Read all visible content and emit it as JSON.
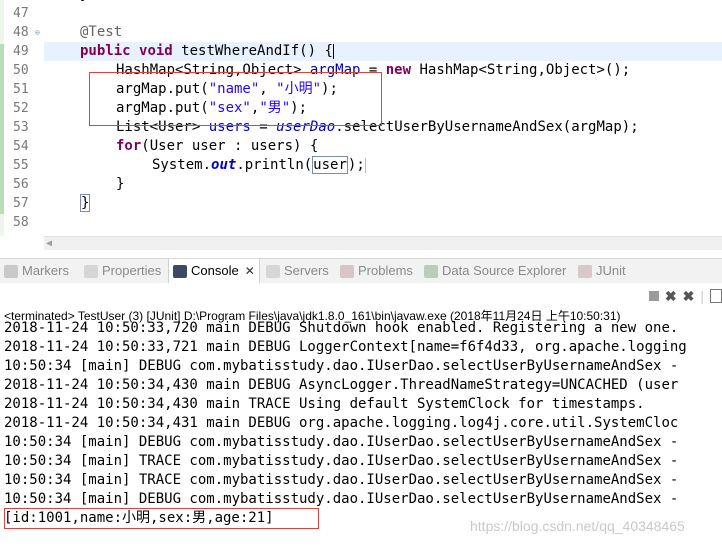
{
  "editor": {
    "line_numbers": [
      "47",
      "48",
      "49",
      "50",
      "51",
      "52",
      "53",
      "54",
      "55",
      "56",
      "57",
      "58"
    ],
    "fold_marker": "⊖",
    "code": {
      "l47": "    }",
      "l48_ann": "@Test",
      "l49_kw1": "public",
      "l49_kw2": "void",
      "l49_rest": " testWhereAndIf() {",
      "l50_a": "HashMap<String,Object> ",
      "l50_var": "argMap",
      "l50_b": " = ",
      "l50_kw": "new",
      "l50_c": " HashMap<String,Object>();",
      "l51_a": "argMap.put(",
      "l51_s1": "\"name\"",
      "l51_b": ", ",
      "l51_s2": "\"小明\"",
      "l51_c": ");",
      "l52_a": "argMap.put(",
      "l52_s1": "\"sex\"",
      "l52_b": ",",
      "l52_s2": "\"男\"",
      "l52_c": ");",
      "l53_a": "List<User> ",
      "l53_var": "users",
      "l53_b": " = ",
      "l53_fld": "userDao",
      "l53_c": ".selectUserByUsernameAndSex(argMap);",
      "l54_kw": "for",
      "l54_rest": "(User user : users) {",
      "l55_a": "System.",
      "l55_out": "out",
      "l55_b": ".println(",
      "l55_var": "user",
      "l55_c": ");",
      "l56": "}",
      "l57": "}"
    }
  },
  "tabs": [
    {
      "label": "Markers"
    },
    {
      "label": "Properties"
    },
    {
      "label": "Console"
    },
    {
      "label": "Servers"
    },
    {
      "label": "Problems"
    },
    {
      "label": "Data Source Explorer"
    },
    {
      "label": "JUnit"
    }
  ],
  "console": {
    "terminated": "<terminated> TestUser (3) [JUnit] D:\\Program Files\\java\\jdk1.8.0_161\\bin\\javaw.exe (2018年11月24日 上午10:50:31)",
    "lines": [
      "2018-11-24 10:50:33,720 main DEBUG Shutdown hook enabled. Registering a new one.",
      "2018-11-24 10:50:33,721 main DEBUG LoggerContext[name=f6f4d33, org.apache.logging",
      "10:50:34 [main] DEBUG com.mybatisstudy.dao.IUserDao.selectUserByUsernameAndSex -",
      "2018-11-24 10:50:34,430 main DEBUG AsyncLogger.ThreadNameStrategy=UNCACHED (user",
      "2018-11-24 10:50:34,430 main TRACE Using default SystemClock for timestamps.",
      "2018-11-24 10:50:34,431 main DEBUG org.apache.logging.log4j.core.util.SystemCloc",
      "10:50:34 [main] DEBUG com.mybatisstudy.dao.IUserDao.selectUserByUsernameAndSex -",
      "10:50:34 [main] TRACE com.mybatisstudy.dao.IUserDao.selectUserByUsernameAndSex -",
      "10:50:34 [main] TRACE com.mybatisstudy.dao.IUserDao.selectUserByUsernameAndSex -",
      "10:50:34 [main] DEBUG com.mybatisstudy.dao.IUserDao.selectUserByUsernameAndSex -",
      "[id:1001,name:小明,sex:男,age:21]"
    ]
  },
  "watermark": "https://blog.csdn.net/qq_40348465",
  "colors": {
    "keyword": "#7f0055",
    "string": "#2a00ff",
    "field": "#0000c0",
    "highlight_box": "#d9453d"
  },
  "icons": [
    "markers-icon",
    "properties-icon",
    "console-icon",
    "servers-icon",
    "problems-icon",
    "data-source-explorer-icon",
    "junit-icon",
    "terminate-icon",
    "remove-launch-icon",
    "remove-all-icon",
    "pin-icon"
  ]
}
